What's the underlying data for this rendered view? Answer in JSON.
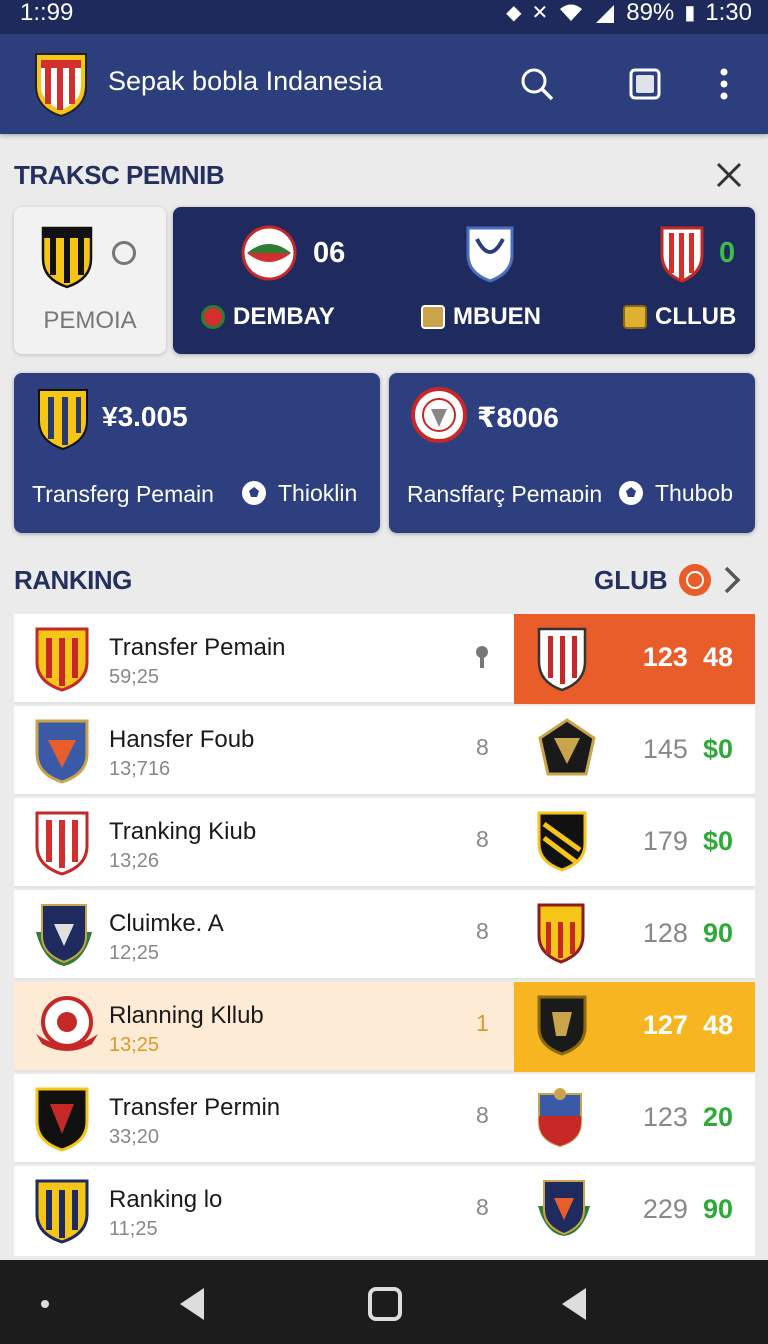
{
  "status": {
    "time_left": "1::99",
    "battery": "89%",
    "time_right": "1:30"
  },
  "app": {
    "title": "Sepak bobla Indanesia"
  },
  "icons": {
    "search": "search-icon",
    "tab": "square-icon",
    "menu": "more-vert-icon",
    "close": "close-icon"
  },
  "transfer_section": {
    "title": "TRAKSC PEMNIB"
  },
  "stat_card": {
    "label": "PEMOIA"
  },
  "match": {
    "score_left": "06",
    "score_right": "0",
    "teams": [
      "DEMBAY",
      "MBUEN",
      "CLLUB"
    ]
  },
  "transfer_cards": [
    {
      "amount": "¥3.005",
      "label": "Transferg Pemain",
      "extra": "Thioklin"
    },
    {
      "amount": "₹8006",
      "label": "Ransffarç Pemaɒin",
      "extra": "Thubob"
    }
  ],
  "ranking": {
    "title": "RANKING",
    "club_link": "GLUB",
    "rows": [
      {
        "name": "Transfer Pemain",
        "sub": "59;25",
        "mid": "",
        "score_a": "123",
        "score_b": "48",
        "highlight": "orange"
      },
      {
        "name": "Hansfer Foub",
        "sub": "13;716",
        "mid": "8",
        "score_a": "145",
        "score_b": "$0",
        "highlight": ""
      },
      {
        "name": "Tranking Kiub",
        "sub": "13;26",
        "mid": "8",
        "score_a": "179",
        "score_b": "$0",
        "highlight": ""
      },
      {
        "name": "Cluimke. A",
        "sub": "12;25",
        "mid": "8",
        "score_a": "128",
        "score_b": "90",
        "highlight": ""
      },
      {
        "name": "Rlanning Kllub",
        "sub": "13;25",
        "mid": "1",
        "score_a": "127",
        "score_b": "48",
        "highlight": "yellow"
      },
      {
        "name": "Transfer Permin",
        "sub": "33;20",
        "mid": "8",
        "score_a": "123",
        "score_b": "20",
        "highlight": ""
      },
      {
        "name": "Ranking lo",
        "sub": "11;25",
        "mid": "8",
        "score_a": "229",
        "score_b": "90",
        "highlight": ""
      }
    ]
  },
  "colors": {
    "primary": "#2c3e7c",
    "dark_navy": "#1f2b5e",
    "accent_orange": "#e85d2a",
    "accent_yellow": "#f6b521",
    "score_green": "#2faa3a"
  }
}
